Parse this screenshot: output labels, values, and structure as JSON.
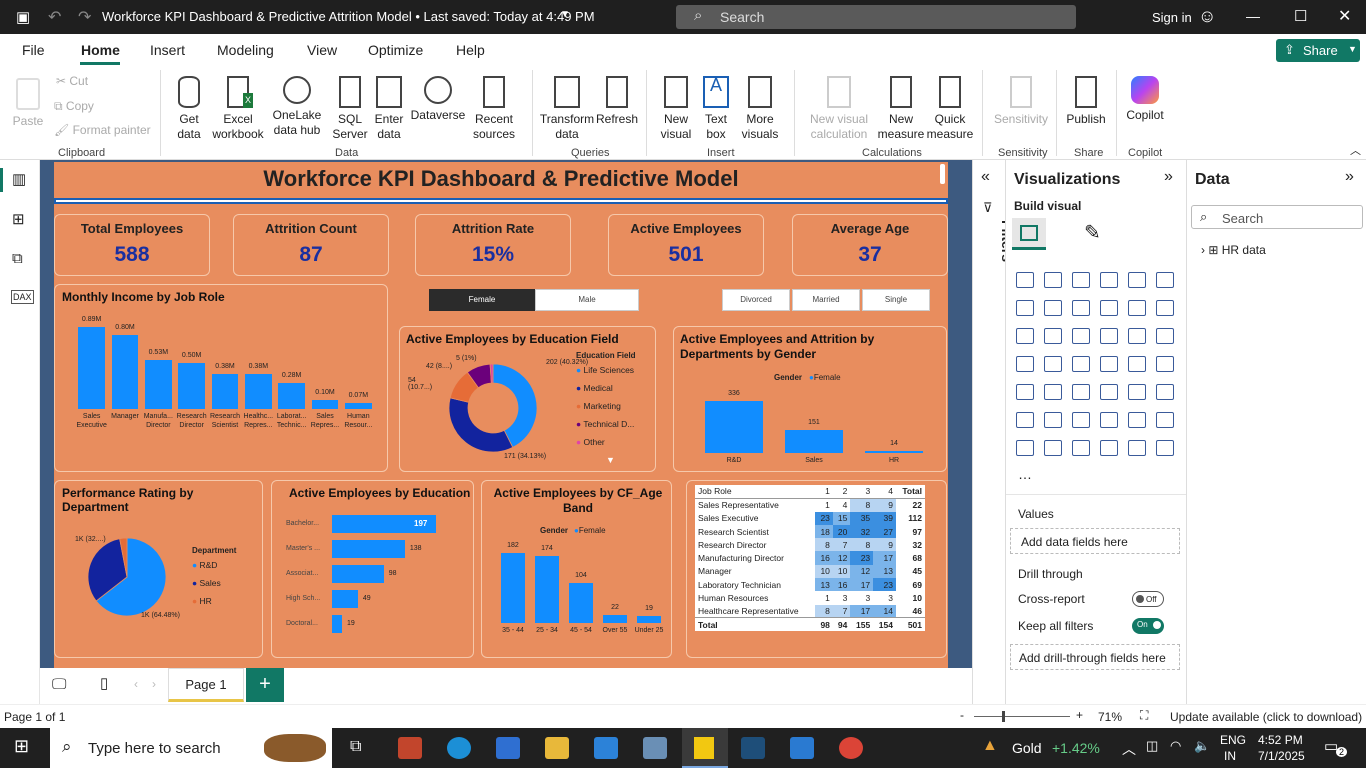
{
  "window": {
    "title": "Workforce KPI Dashboard & Predictive Attrition Model • Last saved: Today at 4:49 PM",
    "search_placeholder": "Search",
    "signin": "Sign in"
  },
  "tabs": [
    "File",
    "Home",
    "Insert",
    "Modeling",
    "View",
    "Optimize",
    "Help"
  ],
  "share_label": "Share",
  "ribbon": {
    "clipboard": {
      "paste": "Paste",
      "cut": "Cut",
      "copy": "Copy",
      "format_painter": "Format painter",
      "group": "Clipboard"
    },
    "data": {
      "get_data": "Get data",
      "excel": "Excel workbook",
      "onelake": "OneLake data hub",
      "sql": "SQL Server",
      "enter": "Enter data",
      "dataverse": "Dataverse",
      "recent": "Recent sources",
      "group": "Data"
    },
    "queries": {
      "transform": "Transform data",
      "refresh": "Refresh",
      "group": "Queries"
    },
    "insert": {
      "new_visual": "New visual",
      "text_box": "Text box",
      "more_visuals": "More visuals",
      "group": "Insert"
    },
    "calculations": {
      "new_visual_calc": "New visual calculation",
      "new_measure": "New measure",
      "quick_measure": "Quick measure",
      "group": "Calculations"
    },
    "sensitivity": {
      "label": "Sensitivity",
      "group": "Sensitivity"
    },
    "share": {
      "publish": "Publish",
      "group": "Share"
    },
    "copilot": {
      "label": "Copilot",
      "group": "Copilot"
    }
  },
  "report": {
    "title": "Workforce KPI Dashboard & Predictive Model",
    "kpis": [
      {
        "label": "Total Employees",
        "value": "588"
      },
      {
        "label": "Attrition Count",
        "value": "87"
      },
      {
        "label": "Attrition Rate",
        "value": "15%"
      },
      {
        "label": "Active Employees",
        "value": "501"
      },
      {
        "label": "Average Age",
        "value": "37"
      }
    ],
    "slicers": {
      "gender": [
        "Female",
        "Male"
      ],
      "marital": [
        "Divorced",
        "Married",
        "Single"
      ]
    },
    "income": {
      "title": "Monthly Income by Job Role"
    },
    "education_field": {
      "title": "Active Employees by Education Field",
      "legend_title": "Education Field",
      "labels": [
        "202 (40.32%)",
        "171 (34.13%)",
        "54 (10.7...)",
        "42 (8....)",
        "5 (1%)"
      ]
    },
    "dept_gender": {
      "title": "Active Employees and Attrition by Departments by Gender",
      "legend_title": "Gender",
      "legend_item": "Female"
    },
    "perf": {
      "title": "Performance Rating by Department",
      "legend_title": "Department",
      "labels": [
        "1K (64.48%)",
        "1K (32....)"
      ]
    },
    "edu": {
      "title": "Active Employees by Education"
    },
    "age": {
      "title": "Active Employees by CF_Age Band",
      "legend_title": "Gender",
      "legend_item": "Female"
    },
    "matrix": {
      "headers": [
        "Job Role",
        "1",
        "2",
        "3",
        "4",
        "Total"
      ],
      "rows": [
        [
          "Sales Representative",
          "1",
          "4",
          "8",
          "9",
          "22"
        ],
        [
          "Sales Executive",
          "23",
          "15",
          "35",
          "39",
          "112"
        ],
        [
          "Research Scientist",
          "18",
          "20",
          "32",
          "27",
          "97"
        ],
        [
          "Research Director",
          "8",
          "7",
          "8",
          "9",
          "32"
        ],
        [
          "Manufacturing Director",
          "16",
          "12",
          "23",
          "17",
          "68"
        ],
        [
          "Manager",
          "10",
          "10",
          "12",
          "13",
          "45"
        ],
        [
          "Laboratory Technician",
          "13",
          "16",
          "17",
          "23",
          "69"
        ],
        [
          "Human Resources",
          "1",
          "3",
          "3",
          "3",
          "10"
        ],
        [
          "Healthcare Representative",
          "8",
          "7",
          "17",
          "14",
          "46"
        ]
      ],
      "total": [
        "Total",
        "98",
        "94",
        "155",
        "154",
        "501"
      ]
    }
  },
  "chart_data": [
    {
      "type": "bar",
      "title": "Monthly Income by Job Role",
      "categories": [
        "Sales Executive",
        "Manager",
        "Manufa... Director",
        "Research Director",
        "Research Scientist",
        "Healthc... Repres...",
        "Laborat... Technic...",
        "Sales Repres...",
        "Human Resour..."
      ],
      "values": [
        0.89,
        0.8,
        0.53,
        0.5,
        0.38,
        0.38,
        0.28,
        0.1,
        0.07
      ],
      "data_labels": [
        "0.89M",
        "0.80M",
        "0.53M",
        "0.50M",
        "0.38M",
        "0.38M",
        "0.28M",
        "0.10M",
        "0.07M"
      ]
    },
    {
      "type": "pie",
      "title": "Active Employees by Education Field",
      "categories": [
        "Life Sciences",
        "Medical",
        "Marketing",
        "Technical D...",
        "Other"
      ],
      "values": [
        202,
        171,
        54,
        42,
        5
      ],
      "colors": [
        "#118dff",
        "#12239e",
        "#e66c37",
        "#6b007b",
        "#e044a7"
      ]
    },
    {
      "type": "bar",
      "title": "Active Employees and Attrition by Departments by Gender",
      "categories": [
        "R&D",
        "Sales",
        "HR"
      ],
      "values": [
        336,
        151,
        14
      ]
    },
    {
      "type": "pie",
      "title": "Performance Rating by Department",
      "categories": [
        "R&D",
        "Sales",
        "HR"
      ],
      "values": [
        64.48,
        32.5,
        3.02
      ],
      "colors": [
        "#118dff",
        "#12239e",
        "#e66c37"
      ]
    },
    {
      "type": "bar",
      "title": "Active Employees by Education",
      "categories": [
        "Bachelor...",
        "Master's ...",
        "Associat...",
        "High Sch...",
        "Doctoral..."
      ],
      "values": [
        197,
        138,
        98,
        49,
        19
      ]
    },
    {
      "type": "bar",
      "title": "Active Employees by CF_Age Band",
      "categories": [
        "35 - 44",
        "25 - 34",
        "45 - 54",
        "Over 55",
        "Under 25"
      ],
      "values": [
        182,
        174,
        104,
        22,
        19
      ]
    }
  ],
  "viz_pane": {
    "title": "Visualizations",
    "build": "Build visual",
    "values": "Values",
    "add_fields": "Add data fields here",
    "drill": "Drill through",
    "cross": "Cross-report",
    "cross_state": "Off",
    "keep": "Keep all filters",
    "keep_state": "On",
    "add_drill": "Add drill-through fields here"
  },
  "data_pane": {
    "title": "Data",
    "search": "Search",
    "table": "HR data"
  },
  "filters_label": "Filters",
  "page_tab": "Page 1",
  "status": {
    "page": "Page 1 of 1",
    "zoom": "71%",
    "update": "Update available (click to download)"
  },
  "taskbar": {
    "search": "Type here to search",
    "ticker": "Gold",
    "change": "+1.42%",
    "lang1": "ENG",
    "lang2": "IN",
    "time": "4:52 PM",
    "date": "7/1/2025",
    "notif": "2"
  }
}
